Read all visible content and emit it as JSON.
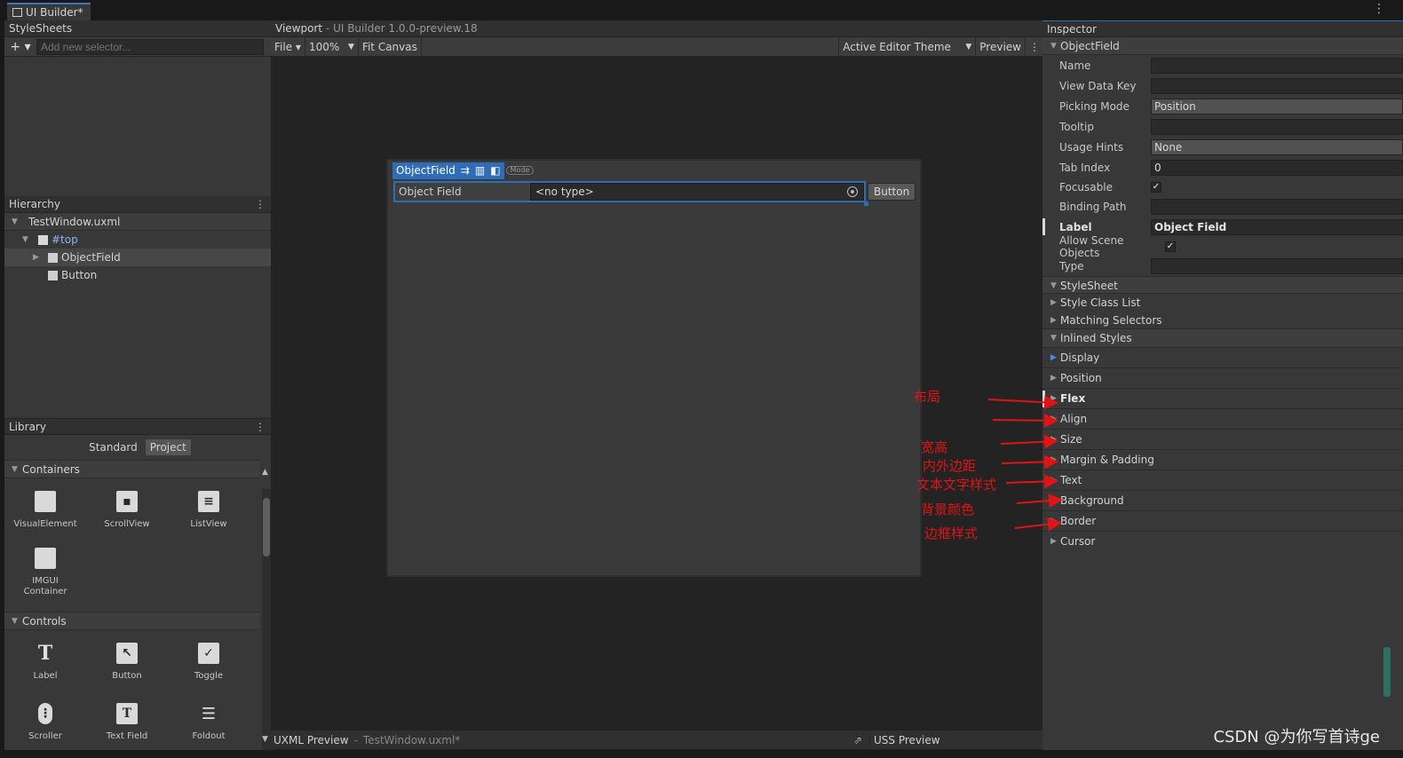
{
  "window": {
    "tab_title": "UI Builder*"
  },
  "stylesheets": {
    "header": "StyleSheets",
    "add_selector_placeholder": "Add new selector..."
  },
  "hierarchy": {
    "header": "Hierarchy",
    "items": [
      {
        "label": "TestWindow.uxml"
      },
      {
        "label": "#top"
      },
      {
        "label": "ObjectField"
      },
      {
        "label": "Button"
      }
    ]
  },
  "library": {
    "header": "Library",
    "tabs": [
      "Standard",
      "Project"
    ],
    "containers_label": "Containers",
    "containers": [
      {
        "label": "VisualElement"
      },
      {
        "label": "ScrollView"
      },
      {
        "label": "ListView"
      },
      {
        "label": "IMGUI\nContainer"
      }
    ],
    "controls_label": "Controls",
    "controls": [
      {
        "label": "Label"
      },
      {
        "label": "Button"
      },
      {
        "label": "Toggle"
      },
      {
        "label": "Scroller"
      },
      {
        "label": "Text Field"
      },
      {
        "label": "Foldout"
      }
    ]
  },
  "viewport": {
    "header": "Viewport",
    "subtitle": "UI Builder 1.0.0-preview.18",
    "file_menu": "File",
    "zoom": "100%",
    "fit_canvas": "Fit Canvas",
    "theme": "Active Editor Theme",
    "preview": "Preview",
    "selected_name": "ObjectField",
    "mode_label": "Mode",
    "field_label": "Object Field",
    "field_value": "<no type>",
    "button_label": "Button",
    "uxml_preview": "UXML Preview",
    "uxml_file": "TestWindow.uxml*",
    "uss_preview": "USS Preview"
  },
  "inspector": {
    "header": "Inspector",
    "element_section": "ObjectField",
    "props": {
      "name_label": "Name",
      "name_value": "",
      "vdk_label": "View Data Key",
      "vdk_value": "",
      "picking_label": "Picking Mode",
      "picking_value": "Position",
      "tooltip_label": "Tooltip",
      "tooltip_value": "",
      "usage_label": "Usage Hints",
      "usage_value": "None",
      "tab_label": "Tab Index",
      "tab_value": "0",
      "focusable_label": "Focusable",
      "binding_label": "Binding Path",
      "binding_value": "",
      "label_label": "Label",
      "label_value": "Object Field",
      "allow_label": "Allow Scene Objects",
      "type_label": "Type",
      "type_value": ""
    },
    "stylesheet_section": "StyleSheet",
    "style_class_list": "Style Class List",
    "matching_selectors": "Matching Selectors",
    "inlined_section": "Inlined Styles",
    "folds": {
      "display": "Display",
      "position": "Position",
      "flex": "Flex",
      "align": "Align",
      "size": "Size",
      "margin": "Margin & Padding",
      "text": "Text",
      "background": "Background",
      "border": "Border",
      "cursor": "Cursor"
    }
  },
  "annotations": {
    "layout": "布局",
    "size": "宽高",
    "margin": "内外边距",
    "text": "文本文字样式",
    "background": "背景颜色",
    "border": "边框样式"
  },
  "watermark": "CSDN @为你写首诗ge",
  "colors": {
    "accent": "#2f6eb7",
    "annotation": "#e01414",
    "panel": "#383838",
    "canvas": "#3a3a3a"
  }
}
